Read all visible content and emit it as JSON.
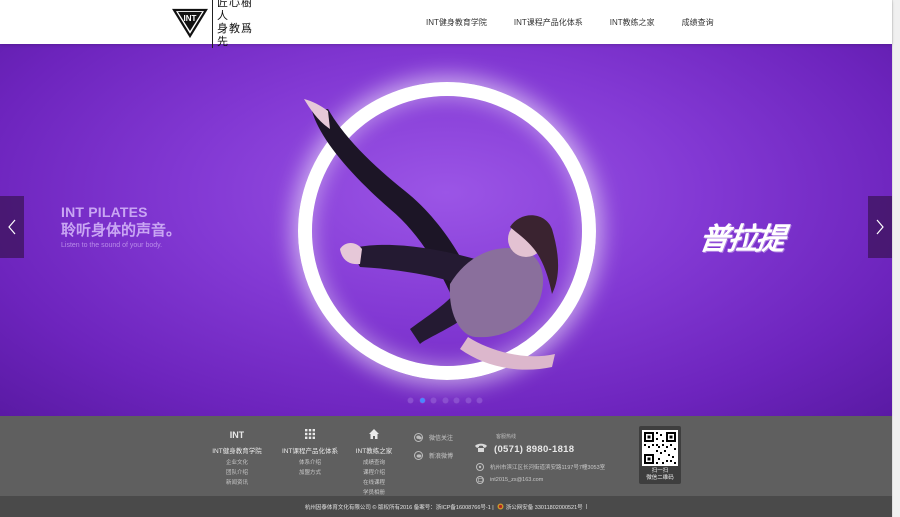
{
  "header": {
    "logo_text_line1": "匠心樹人",
    "logo_text_line2": "身教爲先",
    "logo_mark_text": "INT",
    "nav": [
      {
        "label": "INT健身教育学院"
      },
      {
        "label": "INT课程产品化体系"
      },
      {
        "label": "INT教练之家"
      },
      {
        "label": "成绩查询"
      }
    ]
  },
  "banner": {
    "slogan_en_title": "INT PILATES",
    "slogan_cn": "聆听身体的声音。",
    "slogan_sub": "Listen to the sound of your body.",
    "brush_text": "普拉提",
    "slide_count": 7,
    "active_slide": 2,
    "colors": {
      "bg": "#8339d4",
      "dot_active": "#4a87ff"
    }
  },
  "footer": {
    "columns": [
      {
        "icon": "int-logo-icon",
        "icon_text": "INT",
        "title": "INT健身教育学院",
        "items": [
          "企业文化",
          "团队介绍",
          "新闻资讯"
        ]
      },
      {
        "icon": "grid-icon",
        "title": "INT课程产品化体系",
        "items": [
          "体系介绍",
          "加盟方式"
        ]
      },
      {
        "icon": "home-icon",
        "title": "INT教练之家",
        "items": [
          "成绩查询",
          "课程介绍",
          "在线课程",
          "学员相册"
        ]
      }
    ],
    "follow": [
      {
        "icon": "wechat-icon",
        "label": "微信关注"
      },
      {
        "icon": "weibo-icon",
        "label": "新浪微博"
      }
    ],
    "contact": {
      "hotline_label": "客服热线",
      "phone": "(0571) 8980-1818",
      "address": "杭州市滨江区长河街道滨安路1197号7幢3053室",
      "email": "int2015_zs@163.com"
    },
    "qr": {
      "line1": "扫一扫",
      "line2": "微信二维码"
    },
    "copyright": {
      "main": "杭州因泰体育文化有限公司 © 版权所有2016    备案号：浙ICP备16008766号-1 |",
      "police": "浙公网安备 33011802000521号",
      "tail": "|"
    }
  }
}
